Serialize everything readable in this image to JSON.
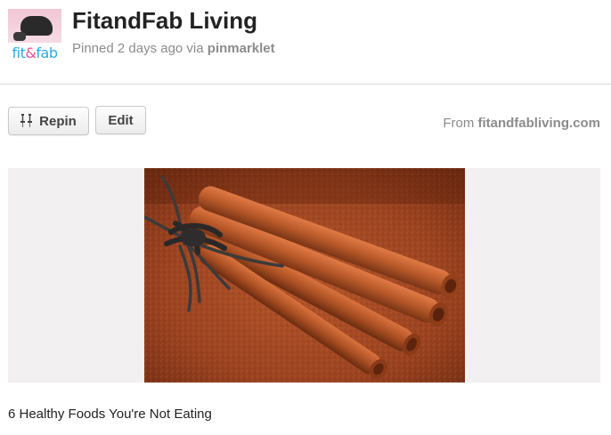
{
  "header": {
    "avatar": {
      "logo_parts": [
        "fit",
        "&",
        "fab"
      ]
    },
    "title": "FitandFab Living",
    "pinned_prefix": "Pinned 2 days ago via",
    "pinned_via": "pinmarklet"
  },
  "actions": {
    "repin_label": "Repin",
    "edit_label": "Edit",
    "from_prefix": "From",
    "from_source": "fitandfabliving.com"
  },
  "pin": {
    "image_icon": "cinnamon-sticks-photo",
    "description": "6 Healthy Foods You're Not Eating"
  },
  "colors": {
    "logo_blue": "#29abe2",
    "logo_pink": "#ec4f8f",
    "muted_text": "#8c8c8c",
    "image_frame_bg": "#f2f0f0"
  }
}
